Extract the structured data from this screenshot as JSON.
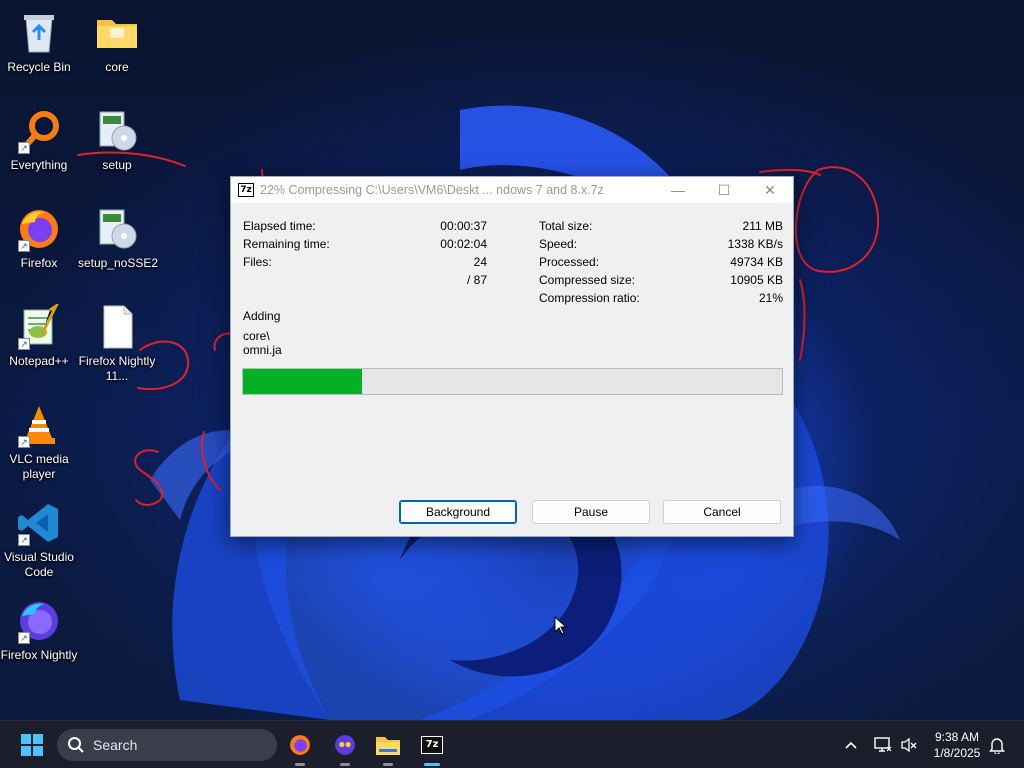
{
  "desktop": {
    "icons": [
      {
        "label": "Recycle Bin",
        "icon": "recycle-bin-icon"
      },
      {
        "label": "core",
        "icon": "folder-icon"
      },
      {
        "label": "Everything",
        "icon": "everything-search-icon"
      },
      {
        "label": "setup",
        "icon": "installer-icon"
      },
      {
        "label": "Firefox",
        "icon": "firefox-icon"
      },
      {
        "label": "setup_noSSE2",
        "icon": "installer-icon"
      },
      {
        "label": "Notepad++",
        "icon": "notepad-plus-plus-icon"
      },
      {
        "label": "Firefox Nightly 11...",
        "icon": "file-icon"
      },
      {
        "label": "VLC media player",
        "icon": "vlc-icon"
      },
      {
        "label": "Visual Studio Code",
        "icon": "vscode-icon"
      },
      {
        "label": "Firefox Nightly",
        "icon": "firefox-nightly-icon"
      }
    ]
  },
  "dialog": {
    "app_icon_text": "7z",
    "title": "22% Compressing C:\\Users\\VM6\\Deskt ... ndows 7 and 8.x.7z",
    "window_controls": {
      "minimize": "—",
      "maximize": "☐",
      "close": "✕"
    },
    "left_stats": [
      {
        "label": "Elapsed time:",
        "value": "00:00:37"
      },
      {
        "label": "Remaining time:",
        "value": "00:02:04"
      },
      {
        "label": "Files:",
        "value": "24"
      },
      {
        "label": "",
        "value": "/ 87"
      }
    ],
    "right_stats": [
      {
        "label": "Total size:",
        "value": "211 MB"
      },
      {
        "label": "Speed:",
        "value": "1338 KB/s"
      },
      {
        "label": "Processed:",
        "value": "49734 KB"
      },
      {
        "label": "Compressed size:",
        "value": "10905 KB"
      },
      {
        "label": "Compression ratio:",
        "value": "21%"
      }
    ],
    "status_action": "Adding",
    "current_folder": "core\\",
    "current_file": "omni.ja",
    "progress_fraction": 0.22,
    "buttons": {
      "background": "Background",
      "pause": "Pause",
      "cancel": "Cancel"
    }
  },
  "taskbar": {
    "search_label": "Search",
    "apps": [
      "start-icon",
      "firefox-icon",
      "firefox-nightly-icon",
      "file-explorer-icon",
      "7zip-icon"
    ],
    "clock_time": "9:38 AM",
    "clock_date": "1/8/2025"
  },
  "colors": {
    "progress_fill": "#06b025",
    "taskbar_bg": "#1c1f2b",
    "accent": "#0067c0"
  }
}
